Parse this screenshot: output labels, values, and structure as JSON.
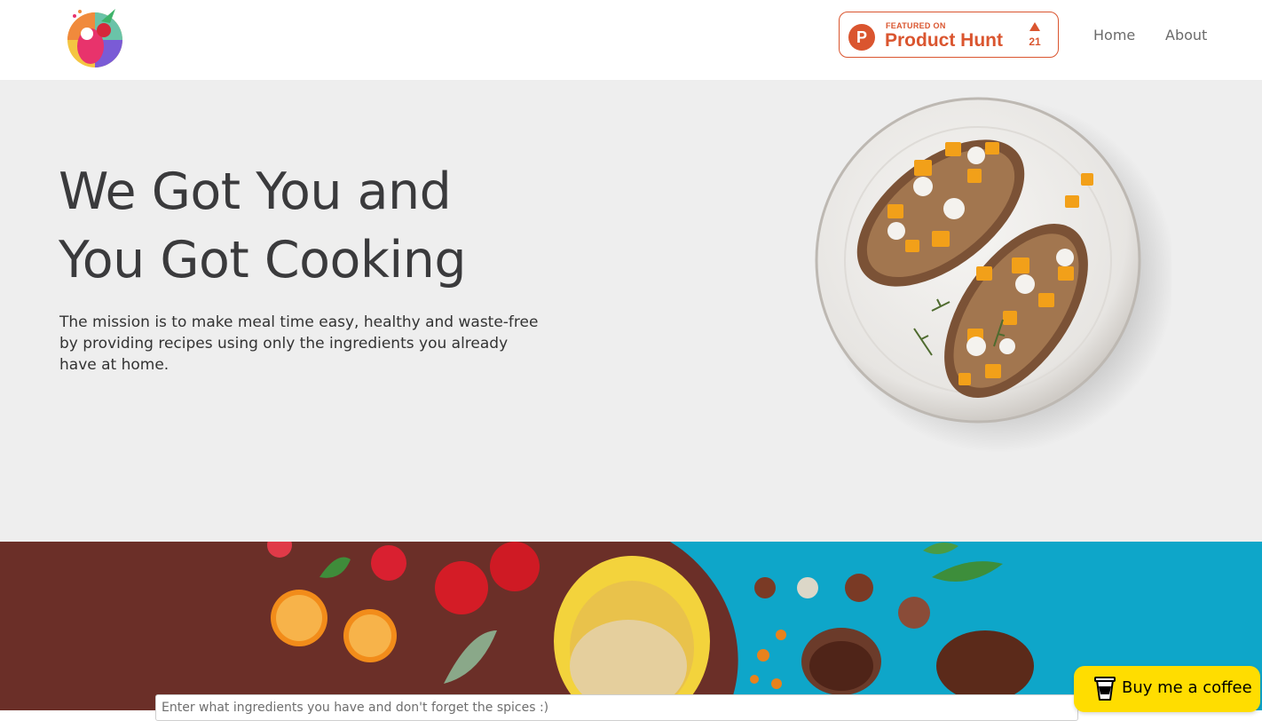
{
  "header": {
    "logo_icon": "rainbow-chef-logo",
    "product_hunt": {
      "featured_label": "FEATURED ON",
      "name": "Product Hunt",
      "letter": "P",
      "upvotes": "21",
      "color": "#da552f"
    },
    "nav": {
      "home": "Home",
      "about": "About"
    }
  },
  "hero": {
    "title_line1": "We Got You and",
    "title_line2": "You Got Cooking",
    "description": "The mission is to make meal time easy, healthy and waste-free by providing recipes using only the ingredients you already have at home.",
    "background": "#eeeeee",
    "image_icon": "toast-plate-photo"
  },
  "search": {
    "placeholder": "Enter what ingredients you have and don't forget the spices :)"
  },
  "coffee": {
    "label": "Buy me a coffee",
    "color": "#ffdd00",
    "icon": "coffee-cup-icon"
  },
  "banner": {
    "image_icon": "ingredients-banner-photo"
  }
}
